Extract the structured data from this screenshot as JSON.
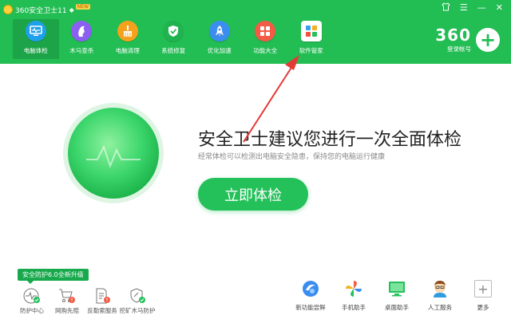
{
  "app": {
    "title": "360安全卫士11",
    "new_badge": "NEW"
  },
  "window_controls": {
    "shirt": "🏷",
    "menu": "☰",
    "minimize": "—",
    "close": "✕"
  },
  "nav": [
    {
      "label": "电脑体检",
      "icon": "monitor-icon",
      "color": "#1fa0ea"
    },
    {
      "label": "木马查杀",
      "icon": "horse-icon",
      "color": "#8b5ff0"
    },
    {
      "label": "电脑清理",
      "icon": "broom-icon",
      "color": "#f4a21d"
    },
    {
      "label": "系统修复",
      "icon": "shield-icon",
      "color": "#20b350"
    },
    {
      "label": "优化加速",
      "icon": "rocket-icon",
      "color": "#3b8df0"
    },
    {
      "label": "功能大全",
      "icon": "grid-icon",
      "color": "#f25b45"
    },
    {
      "label": "软件管家",
      "icon": "apps-icon",
      "color": "#ffffff"
    }
  ],
  "account": {
    "brand": "360",
    "login": "登录帐号"
  },
  "main": {
    "title": "安全卫士建议您进行一次全面体检",
    "subtitle": "经常体检可以检测出电脑安全隐患，保持您的电脑运行健康",
    "button": "立即体检"
  },
  "protection": {
    "upgrade_badge": "安全防护6.0全新升级",
    "items": [
      {
        "label": "防护中心",
        "icon": "pulse-icon"
      },
      {
        "label": "网购先赔",
        "icon": "cart-icon"
      },
      {
        "label": "反勒索服务",
        "icon": "document-shield-icon"
      },
      {
        "label": "挖矿木马防护",
        "icon": "mining-shield-icon"
      }
    ]
  },
  "tools": [
    {
      "label": "新功能尝鲜",
      "icon": "swirl-icon"
    },
    {
      "label": "手机助手",
      "icon": "pinwheel-icon"
    },
    {
      "label": "桌面助手",
      "icon": "desktop-icon"
    },
    {
      "label": "人工服务",
      "icon": "agent-icon"
    },
    {
      "label": "更多",
      "icon": "plus-icon"
    }
  ],
  "colors": {
    "brand_green": "#22bd53",
    "active_nav": "#1ea448",
    "arrow_red": "#e53935"
  }
}
